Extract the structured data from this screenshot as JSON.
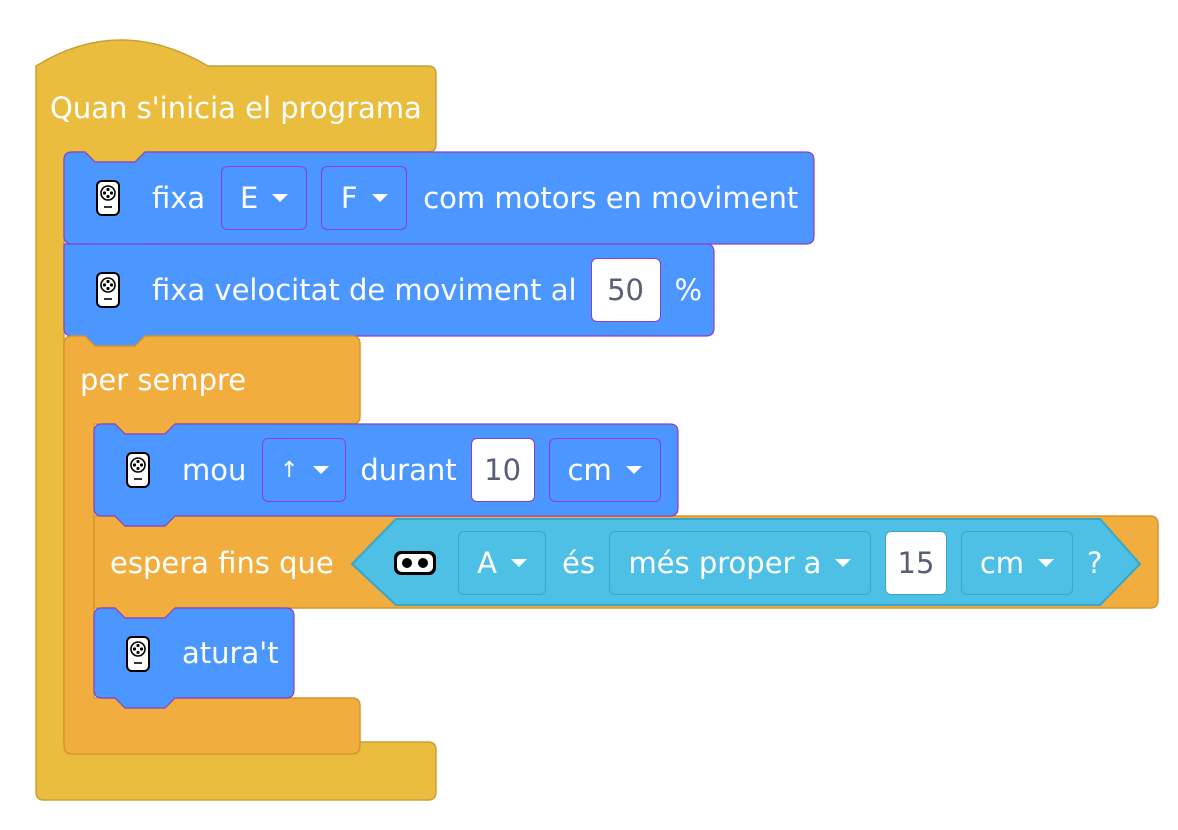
{
  "hat": {
    "label": "Quan s'inicia el programa"
  },
  "set_motors": {
    "label_fixa": "fixa",
    "motor_1": "E",
    "motor_2": "F",
    "label_suffix": "com motors en moviment"
  },
  "set_speed": {
    "label": "fixa velocitat de moviment al",
    "value": "50",
    "unit": "%"
  },
  "forever": {
    "label": "per sempre"
  },
  "move": {
    "label_mou": "mou",
    "direction": "↑",
    "label_durant": "durant",
    "amount": "10",
    "unit": "cm"
  },
  "wait_until": {
    "label": "espera fins que",
    "condition": {
      "port": "A",
      "label_es": "és",
      "comparison": "més proper a",
      "distance": "15",
      "unit": "cm",
      "question": "?"
    }
  },
  "stop": {
    "label": "atura't"
  },
  "colors": {
    "events": "#EBBD3F",
    "control": "#F1AD3E",
    "motion": "#4C97FF",
    "sensor": "#4EC0E6",
    "sensor_dark": "#3aa5c6",
    "accent_border": "#8c3ec8"
  }
}
